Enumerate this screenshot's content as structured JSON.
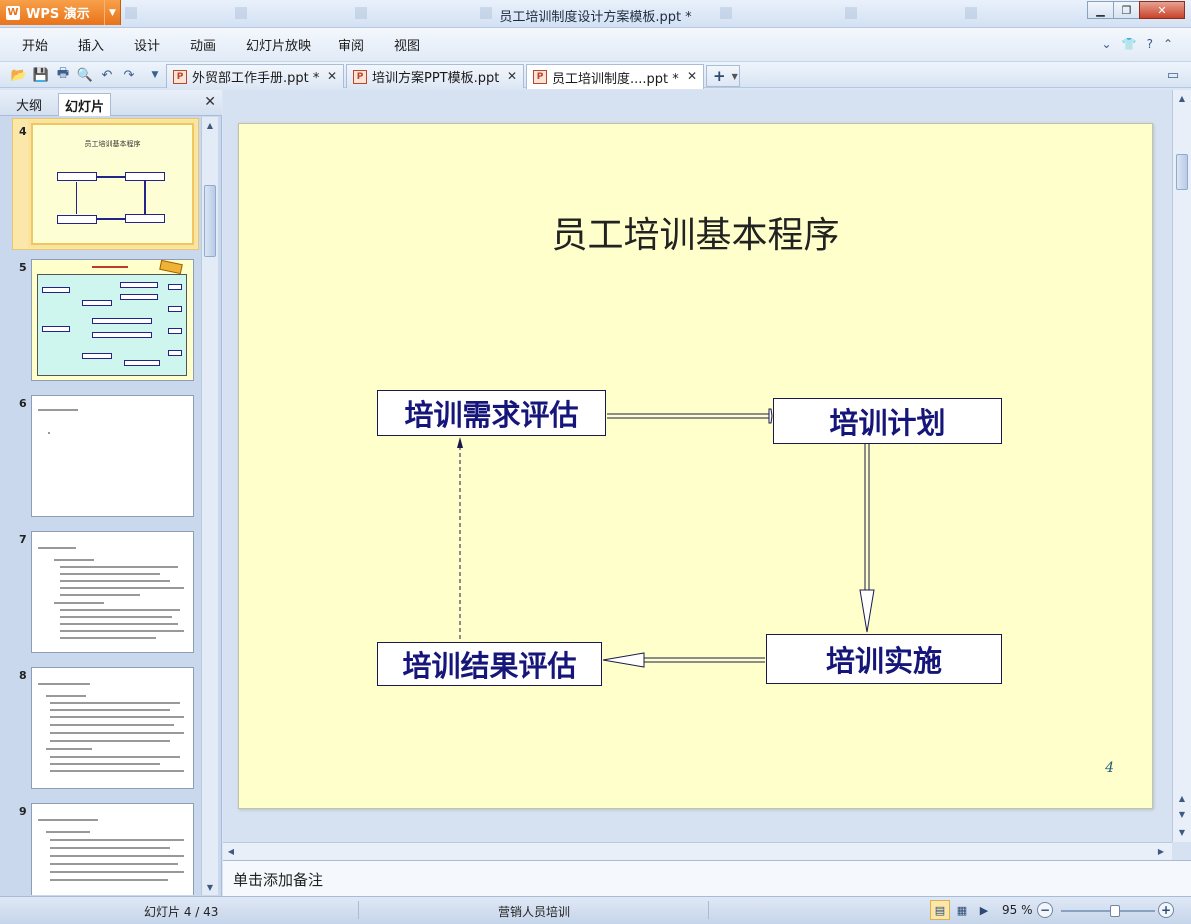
{
  "app": {
    "brand": "WPS 演示",
    "window_title": "员工培训制度设计方案模板.ppt *"
  },
  "menu": [
    "开始",
    "插入",
    "设计",
    "动画",
    "幻灯片放映",
    "审阅",
    "视图"
  ],
  "doc_tabs": [
    {
      "label": "外贸部工作手册.ppt *",
      "active": false
    },
    {
      "label": "培训方案PPT模板.ppt",
      "active": false
    },
    {
      "label": "员工培训制度....ppt *",
      "active": true
    }
  ],
  "left_panel": {
    "tabs": [
      "大纲",
      "幻灯片"
    ],
    "active_tab": "幻灯片",
    "thumbnails": [
      {
        "number": "4",
        "selected": true
      },
      {
        "number": "5",
        "selected": false
      },
      {
        "number": "6",
        "selected": false
      },
      {
        "number": "7",
        "selected": false
      },
      {
        "number": "8",
        "selected": false
      },
      {
        "number": "9",
        "selected": false
      }
    ]
  },
  "slide": {
    "title": "员工培训基本程序",
    "boxes": {
      "needs": "培训需求评估",
      "plan": "培训计划",
      "implement": "培训实施",
      "result": "培训结果评估"
    },
    "page_number": "4",
    "background": "#ffffcc",
    "text_color": "#16167a"
  },
  "notes_placeholder": "单击添加备注",
  "status": {
    "slide_counter": "幻灯片 4 / 43",
    "theme_name": "营销人员培训",
    "zoom": "95 %",
    "zoom_fraction": 0.57
  }
}
